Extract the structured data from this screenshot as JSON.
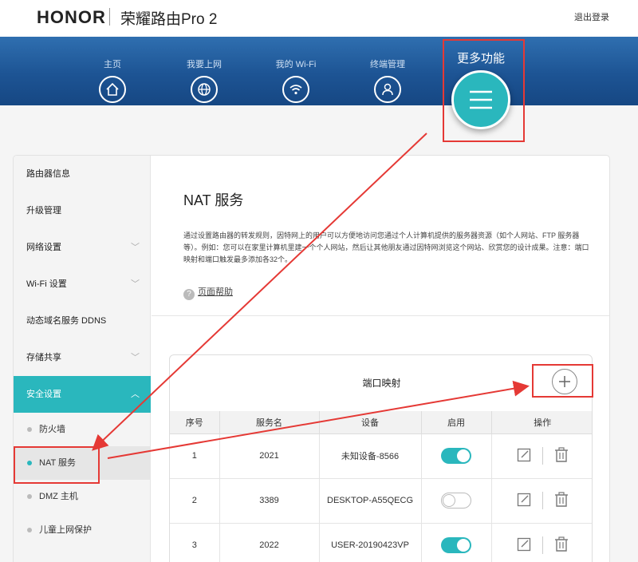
{
  "header": {
    "brand": "HONOR",
    "product": "荣耀路由Pro 2",
    "logout": "退出登录"
  },
  "nav": {
    "items": [
      {
        "label": "主页",
        "icon": "home-icon"
      },
      {
        "label": "我要上网",
        "icon": "globe-icon"
      },
      {
        "label": "我的 Wi-Fi",
        "icon": "wifi-icon"
      },
      {
        "label": "终端管理",
        "icon": "user-icon"
      }
    ],
    "more_label": "更多功能",
    "more_icon": "menu-icon"
  },
  "sidebar": {
    "items": [
      {
        "label": "路由器信息"
      },
      {
        "label": "升级管理"
      },
      {
        "label": "网络设置"
      },
      {
        "label": "Wi-Fi 设置"
      },
      {
        "label": "动态域名服务 DDNS"
      },
      {
        "label": "存储共享"
      },
      {
        "label": "安全设置"
      }
    ],
    "sub_items": [
      {
        "label": "防火墙"
      },
      {
        "label": "NAT 服务"
      },
      {
        "label": "DMZ 主机"
      },
      {
        "label": "儿童上网保护"
      }
    ]
  },
  "content": {
    "title": "NAT 服务",
    "description": "通过设置路由器的转发规则，因特网上的用户可以方便地访问您通过个人计算机提供的服务器资源（如个人网站、FTP 服务器等）。例如：您可以在家里计算机里建一个个人网站，然后让其他朋友通过因特网浏览这个网站、欣赏您的设计成果。注意：端口映射和端口触发最多添加各32个。",
    "help_label": "页面帮助",
    "card_title": "端口映射",
    "columns": [
      "序号",
      "服务名",
      "设备",
      "启用",
      "操作"
    ],
    "rows": [
      {
        "index": "1",
        "service": "2021",
        "device": "未知设备-8566",
        "enabled": true
      },
      {
        "index": "2",
        "service": "3389",
        "device": "DESKTOP-A55QECG",
        "enabled": false
      },
      {
        "index": "3",
        "service": "2022",
        "device": "USER-20190423VP",
        "enabled": true
      }
    ]
  },
  "colors": {
    "accent": "#2ab7bd",
    "nav_band": "#1d5494",
    "annotation": "#e53935"
  }
}
